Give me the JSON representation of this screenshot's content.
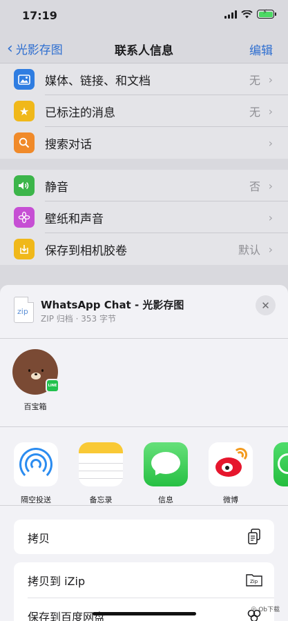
{
  "status": {
    "time": "17:19"
  },
  "nav": {
    "back_label": "光影存图",
    "title": "联系人信息",
    "edit_label": "编辑"
  },
  "rows_group1": [
    {
      "label": "媒体、链接、和文档",
      "value": "无",
      "icon": "photo-icon",
      "color": "#2f7de1"
    },
    {
      "label": "已标注的消息",
      "value": "无",
      "icon": "star-icon",
      "color": "#f0b81a"
    },
    {
      "label": "搜索对话",
      "value": "",
      "icon": "search-icon",
      "color": "#f08a2a"
    }
  ],
  "rows_group2": [
    {
      "label": "静音",
      "value": "否",
      "icon": "speaker-icon",
      "color": "#3cb54a"
    },
    {
      "label": "壁纸和声音",
      "value": "",
      "icon": "flower-icon",
      "color": "#c64fd4"
    },
    {
      "label": "保存到相机胶卷",
      "value": "默认",
      "icon": "download-icon",
      "color": "#f0b81a"
    }
  ],
  "sheet": {
    "file_icon_label": "zip",
    "title": "WhatsApp Chat - 光影存图",
    "subtitle": "ZIP 归档 · 353 字节",
    "close_symbol": "✕"
  },
  "contacts": [
    {
      "name": "百宝箱",
      "badge": "LINE"
    }
  ],
  "apps": [
    {
      "label": "隔空投送",
      "icon": "airdrop-icon"
    },
    {
      "label": "备忘录",
      "icon": "notes-icon"
    },
    {
      "label": "信息",
      "icon": "messages-icon"
    },
    {
      "label": "微博",
      "icon": "weibo-icon"
    }
  ],
  "actions": [
    {
      "label": "拷贝",
      "icon": "copy-icon"
    },
    {
      "label": "拷贝到 iZip",
      "icon": "izip-folder-icon",
      "icon_text": "Zip"
    },
    {
      "label": "保存到百度网盘",
      "icon": "baidu-cloud-icon"
    }
  ],
  "watermark": "Ob下载"
}
